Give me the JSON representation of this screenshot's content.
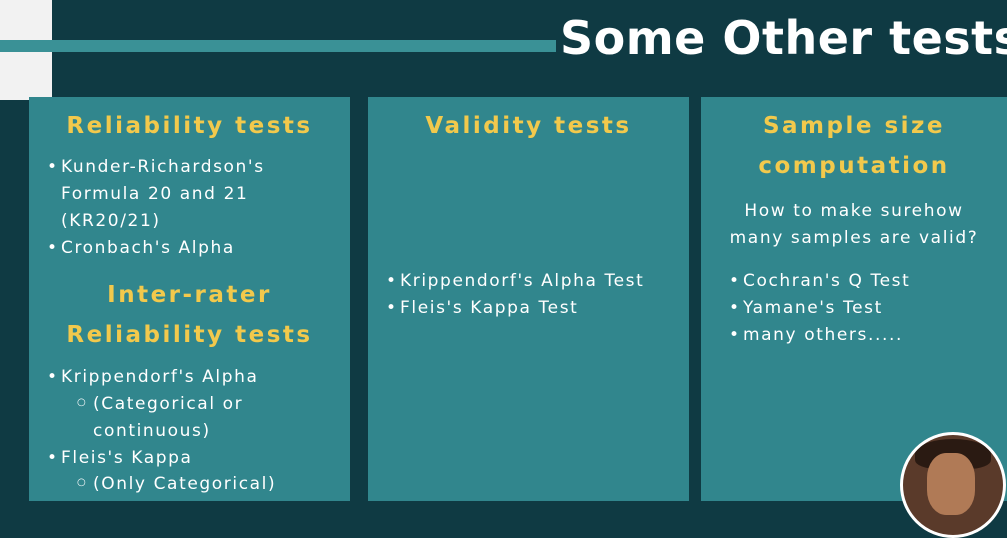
{
  "title": "Some Other tests",
  "panel1": {
    "heading": "Reliability tests",
    "items": [
      "Kunder-Richardson's",
      "Formula 20 and 21",
      "(KR20/21)",
      "Cronbach's Alpha"
    ],
    "subheading1": "Inter-rater",
    "subheading2": "Reliability tests",
    "items2": [
      "Krippendorf's Alpha",
      "(Categorical or",
      "continuous)",
      "Fleis's Kappa",
      "(Only Categorical)"
    ]
  },
  "panel2": {
    "heading": "Validity tests",
    "items": [
      "Krippendorf's Alpha Test",
      "Fleis's Kappa Test"
    ]
  },
  "panel3": {
    "heading1": "Sample size",
    "heading2": "computation",
    "question1": "How to make surehow",
    "question2": "many samples are valid?",
    "items": [
      "Cochran's Q Test",
      "Yamane's Test",
      "many others....."
    ]
  }
}
